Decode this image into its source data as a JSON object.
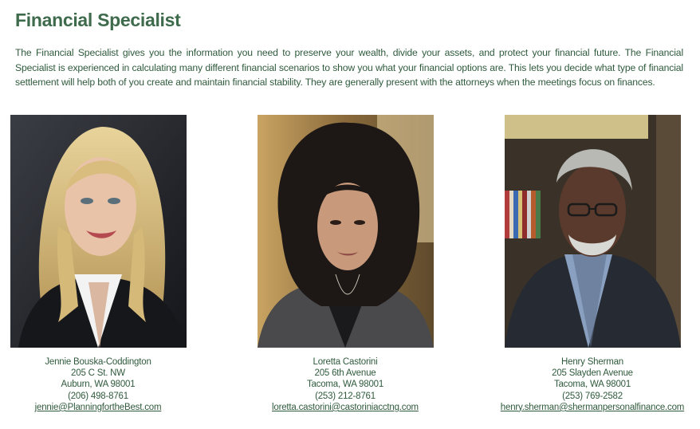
{
  "page": {
    "title": "Financial Specialist",
    "intro": "The Financial Specialist gives you the information you need to preserve your wealth, divide your assets, and protect your financial future. The Financial Specialist is experienced in calculating many different financial scenarios to show you what your financial options are. This lets you decide what type of financial settlement will help both of you create and maintain financial stability. They are generally present with the attorneys when the meetings focus on finances."
  },
  "specialists": [
    {
      "name": "Jennie Bouska-Coddington",
      "street": "205 C St. NW",
      "city": "Auburn, WA 98001",
      "phone": "(206) 498-8761",
      "email": "jennie@PlanningfortheBest.com"
    },
    {
      "name": "Loretta Castorini",
      "street": "205 6th Avenue",
      "city": "Tacoma, WA 98001",
      "phone": "(253) 212-8761",
      "email": "loretta.castorini@castoriniacctng.com"
    },
    {
      "name": "Henry Sherman",
      "street": "205 Slayden Avenue",
      "city": "Tacoma, WA 98001",
      "phone": "(253) 769-2582",
      "email": "henry.sherman@shermanpersonalfinance.com"
    }
  ],
  "colors": {
    "heading": "#3f6b4d",
    "text": "#2f5a3c"
  }
}
